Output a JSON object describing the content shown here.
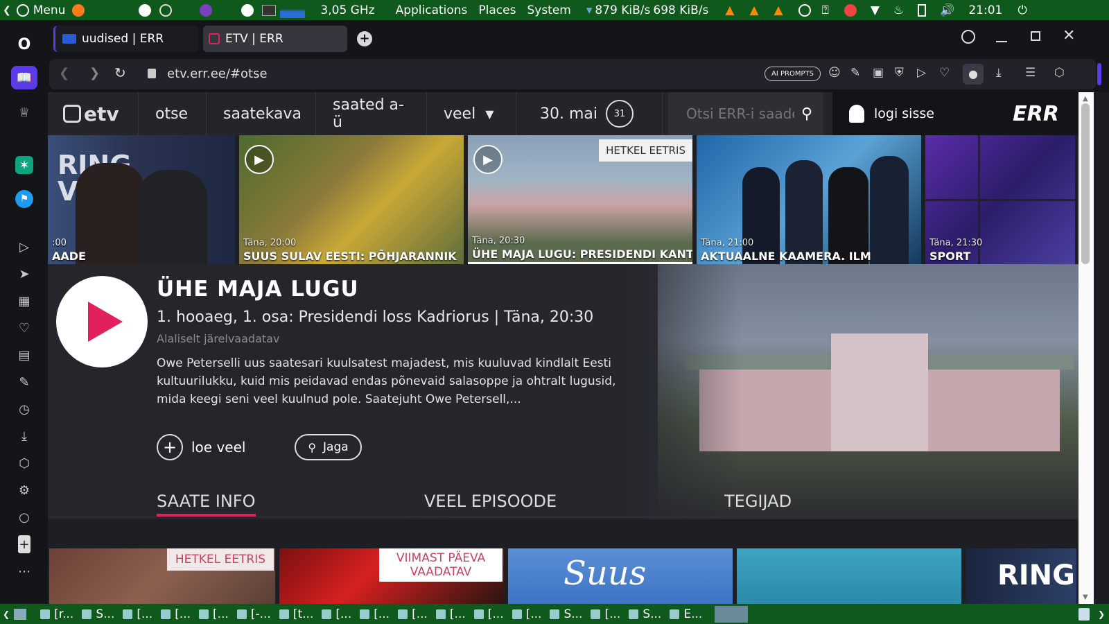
{
  "panel": {
    "menu": "Menu",
    "cpu": "3,05 GHz",
    "applications": "Applications",
    "places": "Places",
    "system": "System",
    "down": "879 KiB/s",
    "up": "698 KiB/s",
    "time": "21:01"
  },
  "browser": {
    "tabs": [
      {
        "label": "uudised | ERR"
      },
      {
        "label": "ETV | ERR"
      }
    ],
    "url": "etv.err.ee/#otse",
    "ai_prompts": "AI PROMPTS"
  },
  "etv": {
    "logo": "etv",
    "nav": [
      "otse",
      "saatekava",
      "saated a-ü"
    ],
    "veel": "veel",
    "date": "30. mai",
    "calendar_day": "31",
    "search_placeholder": "Otsi ERR-i saade",
    "login": "logi sisse",
    "err_logo": "ERR"
  },
  "strip": [
    {
      "time": ":00",
      "title": "AADE",
      "banner_text": "RING VAAD"
    },
    {
      "time": "Täna, 20:00",
      "title": "Suus sulav Eesti: Põhjarannik"
    },
    {
      "time": "Täna, 20:30",
      "title": "Ühe maja lugu: Presidendi kantselei",
      "badge": "HETKEL EETRIS"
    },
    {
      "time": "Täna, 21:00",
      "title": "Aktuaalne kaamera. Ilm"
    },
    {
      "time": "Täna, 21:30",
      "title": "Sport"
    }
  ],
  "hero": {
    "title": "ÜHE MAJA LUGU",
    "subtitle": "1. hooaeg, 1. osa: Presidendi loss Kadriorus | Täna, 20:30",
    "availability": "Alaliselt järelvaadatav",
    "description": "Owe Peterselli uus saatesari kuulsatest majadest, mis kuuluvad kindlalt Eesti kultuurilukku, kuid mis peidavad endas põnevaid salasoppe ja ohtralt lugusid, mida keegi seni veel kuulnud pole. Saatejuht Owe Petersell,...",
    "read_more": "loe veel",
    "share": "Jaga"
  },
  "tabs": [
    "SAATE INFO",
    "VEEL EPISOODE",
    "TEGIJAD"
  ],
  "bottom": [
    {
      "badge": "HETKEL EETRIS"
    },
    {
      "badge": "VIIMAST PÄEVA VAADATAV"
    },
    {
      "text": "Suus"
    },
    {
      "text": ""
    },
    {
      "text": "RING"
    }
  ],
  "taskbar": [
    "[r...",
    "S...",
    "[...",
    "[...",
    "[...",
    "[-...",
    "[t...",
    "[...",
    "[...",
    "[...",
    "[...",
    "[...",
    "[...",
    "S...",
    "[...",
    "S...",
    "E..."
  ],
  "colors": {
    "accent": "#e1215b",
    "panel": "#10591c"
  }
}
